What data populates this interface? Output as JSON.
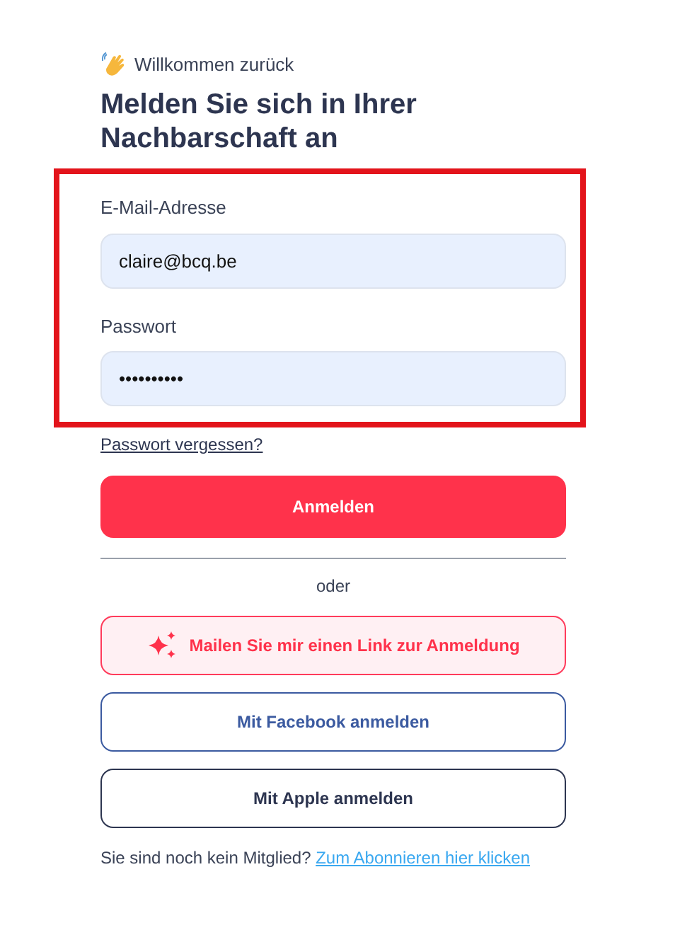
{
  "greeting": "Willkommen zurück",
  "heading": "Melden Sie sich in Ihrer Nachbarschaft an",
  "credentials": {
    "highlighted": true,
    "fields": [
      {
        "label": "E-Mail-Adresse",
        "value": "claire@bcq.be"
      },
      {
        "label": "Passwort",
        "value": "••••••••••"
      }
    ]
  },
  "forgot_link": "Passwort vergessen?",
  "submit_button": "Anmelden",
  "divider_text": "oder",
  "alt_buttons": [
    {
      "kind": "magic",
      "label": "Mailen Sie mir einen Link zur Anmeldung"
    },
    {
      "kind": "facebook",
      "label": "Mit Facebook anmelden"
    },
    {
      "kind": "apple",
      "label": "Mit Apple anmelden"
    }
  ],
  "footer": {
    "text": "Sie sind noch kein Mitglied?",
    "link": "Zum Abonnieren hier klicken"
  }
}
